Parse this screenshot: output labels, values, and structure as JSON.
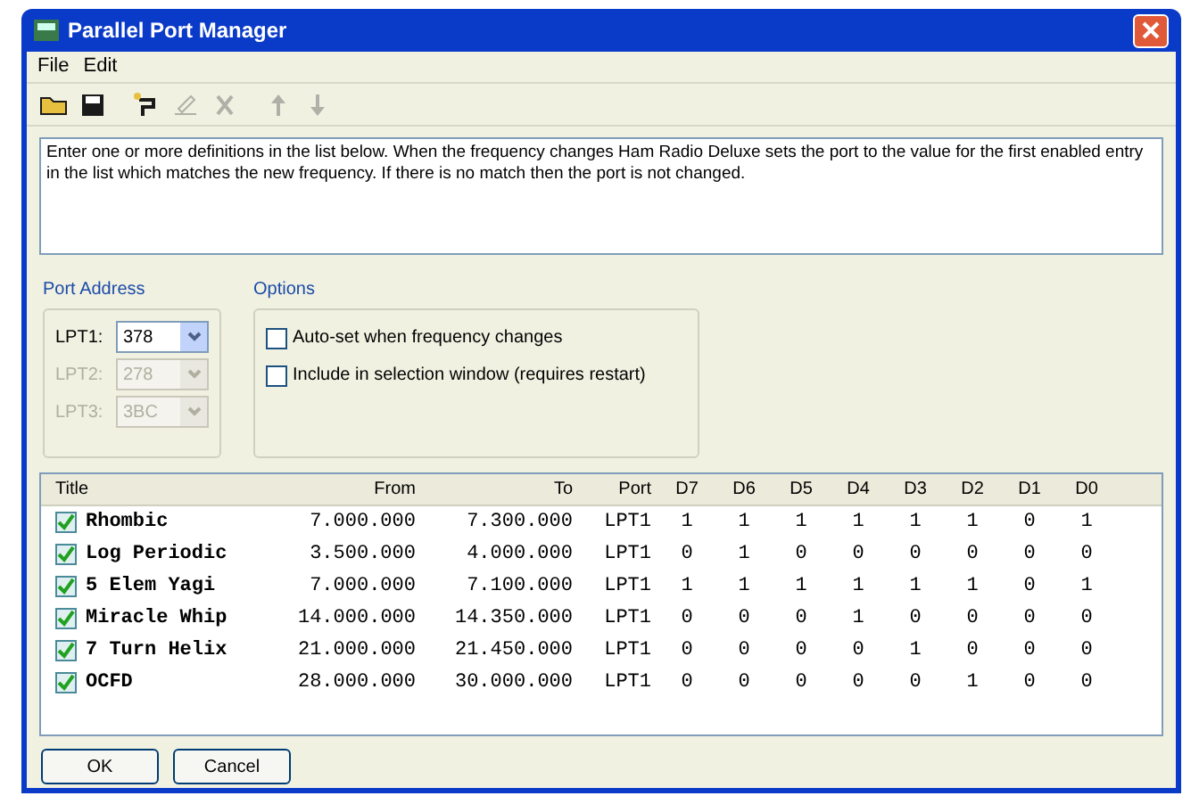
{
  "window": {
    "title": "Parallel Port Manager"
  },
  "menu": [
    "File",
    "Edit"
  ],
  "toolbar": [
    {
      "kind": "open",
      "disabled": false
    },
    {
      "kind": "save",
      "disabled": false
    },
    {
      "kind": "add",
      "disabled": false
    },
    {
      "kind": "edit",
      "disabled": true
    },
    {
      "kind": "delete",
      "disabled": true
    },
    {
      "kind": "up",
      "disabled": true
    },
    {
      "kind": "down",
      "disabled": true
    }
  ],
  "description": "Enter one or more definitions in the list below. When the frequency changes Ham Radio Deluxe sets the port to the value for the first enabled entry in the list which matches the new frequency. If there is no match then the port is not changed.",
  "port_address": {
    "title": "Port Address",
    "ports": [
      {
        "label": "LPT1:",
        "value": "378",
        "disabled": false
      },
      {
        "label": "LPT2:",
        "value": "278",
        "disabled": true
      },
      {
        "label": "LPT3:",
        "value": "3BC",
        "disabled": true
      }
    ]
  },
  "options": {
    "title": "Options",
    "items": [
      {
        "label": "Auto-set when frequency changes",
        "checked": false
      },
      {
        "label": "Include in selection window (requires restart)",
        "checked": false
      }
    ]
  },
  "table": {
    "columns": [
      "Title",
      "From",
      "To",
      "Port",
      "D7",
      "D6",
      "D5",
      "D4",
      "D3",
      "D2",
      "D1",
      "D0"
    ],
    "rows": [
      {
        "checked": true,
        "cells": [
          "Rhombic",
          "7.000.000",
          "7.300.000",
          "LPT1",
          "1",
          "1",
          "1",
          "1",
          "1",
          "1",
          "0",
          "1"
        ]
      },
      {
        "checked": true,
        "cells": [
          "Log Periodic",
          "3.500.000",
          "4.000.000",
          "LPT1",
          "0",
          "1",
          "0",
          "0",
          "0",
          "0",
          "0",
          "0"
        ]
      },
      {
        "checked": true,
        "cells": [
          "5 Elem Yagi",
          "7.000.000",
          "7.100.000",
          "LPT1",
          "1",
          "1",
          "1",
          "1",
          "1",
          "1",
          "0",
          "1"
        ]
      },
      {
        "checked": true,
        "cells": [
          "Miracle Whip",
          "14.000.000",
          "14.350.000",
          "LPT1",
          "0",
          "0",
          "0",
          "1",
          "0",
          "0",
          "0",
          "0"
        ]
      },
      {
        "checked": true,
        "cells": [
          "7 Turn Helix",
          "21.000.000",
          "21.450.000",
          "LPT1",
          "0",
          "0",
          "0",
          "0",
          "1",
          "0",
          "0",
          "0"
        ]
      },
      {
        "checked": true,
        "cells": [
          "OCFD",
          "28.000.000",
          "30.000.000",
          "LPT1",
          "0",
          "0",
          "0",
          "0",
          "0",
          "1",
          "0",
          "0"
        ]
      }
    ]
  },
  "buttons": [
    "OK",
    "Cancel"
  ]
}
